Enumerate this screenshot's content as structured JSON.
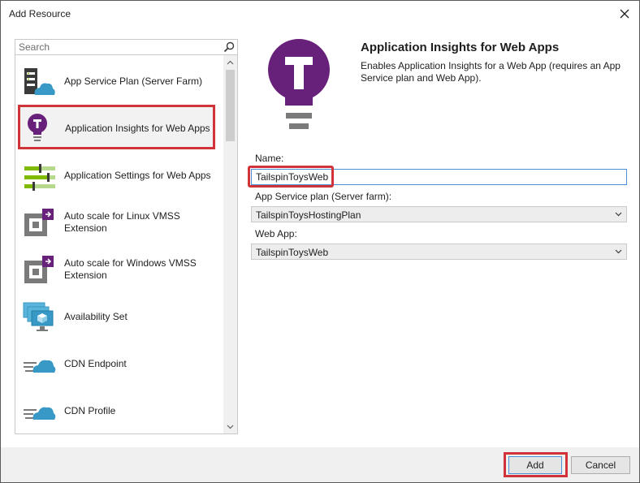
{
  "dialog": {
    "title": "Add Resource",
    "close_icon": "close-icon"
  },
  "search": {
    "placeholder": "Search",
    "icon": "search-icon"
  },
  "resource_list": {
    "items": [
      {
        "label": "App Service Plan (Server Farm)",
        "icon": "app-service-plan-icon",
        "selected": false
      },
      {
        "label": "Application Insights for Web Apps",
        "icon": "lightbulb-icon",
        "selected": true
      },
      {
        "label": "Application Settings for Web Apps",
        "icon": "sliders-icon",
        "selected": false
      },
      {
        "label": "Auto scale for Linux VMSS Extension",
        "icon": "autoscale-icon",
        "selected": false
      },
      {
        "label": "Auto scale for Windows VMSS Extension",
        "icon": "autoscale-icon",
        "selected": false
      },
      {
        "label": "Availability Set",
        "icon": "availability-set-icon",
        "selected": false
      },
      {
        "label": "CDN Endpoint",
        "icon": "cdn-icon",
        "selected": false
      },
      {
        "label": "CDN Profile",
        "icon": "cdn-icon",
        "selected": false
      }
    ]
  },
  "detail": {
    "title": "Application Insights for Web Apps",
    "description": "Enables Application Insights for a Web App (requires an App Service plan and Web App).",
    "icon": "lightbulb-icon",
    "name_label": "Name:",
    "name_value": "TailspinToysWeb",
    "plan_label": "App Service plan (Server farm):",
    "plan_value": "TailspinToysHostingPlan",
    "webapp_label": "Web App:",
    "webapp_value": "TailspinToysWeb"
  },
  "footer": {
    "add_label": "Add",
    "cancel_label": "Cancel"
  },
  "colors": {
    "highlight": "#d13438",
    "accent": "#68217a",
    "focus": "#4a90d9",
    "azure_blue": "#3999c6",
    "green": "#7fba00"
  }
}
